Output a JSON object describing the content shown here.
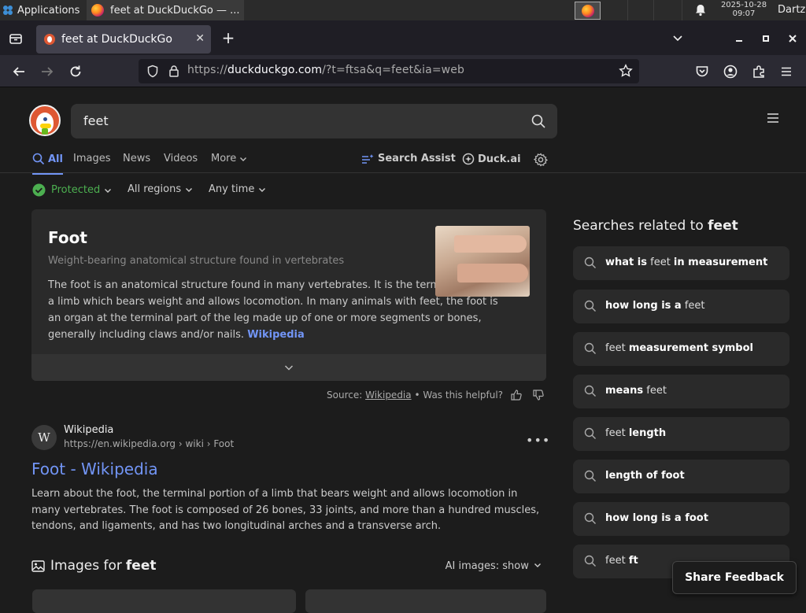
{
  "taskbar": {
    "applications_label": "Applications",
    "window_title": "feet at DuckDuckGo — ...",
    "clock_date": "2025-10-28",
    "clock_time": "09:07",
    "user": "Dartz"
  },
  "browser": {
    "tab_title": "feet at DuckDuckGo",
    "tab_close": "✕",
    "new_tab": "+",
    "url_domain": "duckduckgo.com",
    "url_prefix": "https://",
    "url_path": "/?t=ftsa&q=feet&ia=web"
  },
  "search": {
    "query": "feet",
    "tabs": [
      "All",
      "Images",
      "News",
      "Videos",
      "More"
    ],
    "search_assist": "Search Assist",
    "duck_ai": "Duck.ai",
    "protected": "Protected",
    "regions": "All regions",
    "time": "Any time"
  },
  "knowledge_panel": {
    "title": "Foot",
    "subtitle": "Weight-bearing anatomical structure found in vertebrates",
    "body": "The foot is an anatomical structure found in many vertebrates. It is the terminal portion of a limb which bears weight and allows locomotion. In many animals with feet, the foot is an organ at the terminal part of the leg made up of one or more segments or bones, generally including claws and/or nails.",
    "link": "Wikipedia",
    "source_label": "Source:",
    "source_link": "Wikipedia",
    "helpful": "• Was this helpful?"
  },
  "result": {
    "site_name": "Wikipedia",
    "favicon_letter": "W",
    "breadcrumb": "https://en.wikipedia.org › wiki › Foot",
    "title": "Foot - Wikipedia",
    "snippet": "Learn about the foot, the terminal portion of a limb that bears weight and allows locomotion in many vertebrates. The foot is composed of 26 bones, 33 joints, and more than a hundred muscles, tendons, and ligaments, and has two longitudinal arches and a transverse arch."
  },
  "images_section": {
    "heading_prefix": "Images for",
    "heading_query": "feet",
    "ai_images": "AI images: show"
  },
  "related": {
    "heading_prefix": "Searches related to",
    "heading_query": "feet",
    "items": [
      {
        "pre": "",
        "bold1": "what is",
        "mid": " feet ",
        "bold2": "in measurement"
      },
      {
        "pre": "",
        "bold1": "how long is a",
        "mid": " feet",
        "bold2": ""
      },
      {
        "pre": "feet ",
        "bold1": "measurement symbol",
        "mid": "",
        "bold2": ""
      },
      {
        "pre": "",
        "bold1": "means",
        "mid": " feet",
        "bold2": ""
      },
      {
        "pre": "feet ",
        "bold1": "length",
        "mid": "",
        "bold2": ""
      },
      {
        "pre": "",
        "bold1": "length of foot",
        "mid": "",
        "bold2": ""
      },
      {
        "pre": "",
        "bold1": "how long is a foot",
        "mid": "",
        "bold2": ""
      },
      {
        "pre": "feet ",
        "bold1": "ft",
        "mid": "",
        "bold2": ""
      }
    ]
  },
  "feedback": "Share Feedback",
  "colors": {
    "accent": "#7295f6",
    "protected": "#4caf50",
    "ddg_orange": "#de5833"
  }
}
